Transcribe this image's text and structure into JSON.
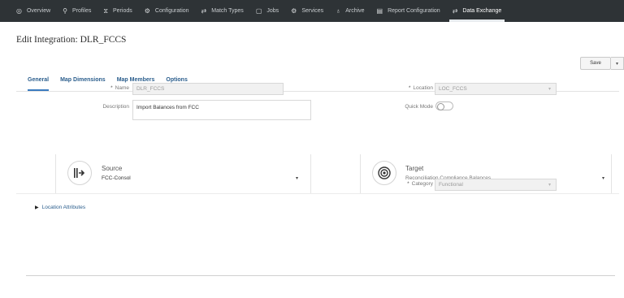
{
  "nav": {
    "items": [
      {
        "icon": "target-icon",
        "glyph": "◎",
        "label": "Overview"
      },
      {
        "icon": "user-icon",
        "glyph": "⚲",
        "label": "Profiles"
      },
      {
        "icon": "periods-icon",
        "glyph": "⧖",
        "label": "Periods"
      },
      {
        "icon": "gear-icon",
        "glyph": "⚙",
        "label": "Configuration"
      },
      {
        "icon": "match-icon",
        "glyph": "⇄",
        "label": "Match Types"
      },
      {
        "icon": "jobs-icon",
        "glyph": "▢",
        "label": "Jobs"
      },
      {
        "icon": "services-icon",
        "glyph": "⚙",
        "label": "Services"
      },
      {
        "icon": "archive-icon",
        "glyph": "♁",
        "label": "Archive"
      },
      {
        "icon": "report-icon",
        "glyph": "▤",
        "label": "Report Configuration"
      },
      {
        "icon": "exchange-icon",
        "glyph": "⇄",
        "label": "Data Exchange"
      }
    ]
  },
  "page": {
    "title": "Edit Integration: DLR_FCCS",
    "save_label": "Save",
    "save_menu_glyph": "▾"
  },
  "tabs": [
    "General",
    "Map Dimensions",
    "Map Members",
    "Options"
  ],
  "form": {
    "name_label": "Name",
    "name_value": "DLR_FCCS",
    "description_label": "Description",
    "description_value": "Import Balances from FCC",
    "location_label": "Location",
    "location_value": "LOC_FCCS",
    "quick_mode_label": "Quick Mode",
    "category_label": "Category",
    "category_value": "Functional"
  },
  "source": {
    "title": "Source",
    "value": "FCC-Consol"
  },
  "target": {
    "title": "Target",
    "value": "Reconciliation Compliance Balances"
  },
  "location_attributes_label": "Location Attributes"
}
